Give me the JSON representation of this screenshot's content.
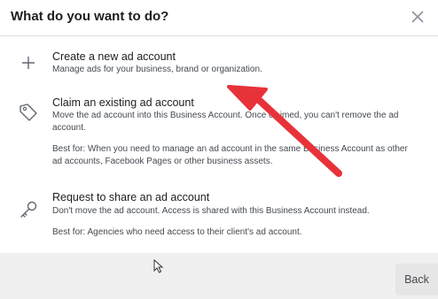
{
  "dialog": {
    "title": "What do you want to do?",
    "options": [
      {
        "icon": "plus-icon",
        "title": "Create a new ad account",
        "desc": "Manage ads for your business, brand or organization."
      },
      {
        "icon": "tag-icon",
        "title": "Claim an existing ad account",
        "desc": "Move the ad account into this Business Account. Once claimed, you can't remove the ad account.",
        "best_for": "Best for: When you need to manage an ad account in the same Business Account as other ad accounts, Facebook Pages or other business assets."
      },
      {
        "icon": "key-icon",
        "title": "Request to share an ad account",
        "desc": "Don't move the ad account. Access is shared with this Business Account instead.",
        "best_for": "Best for: Agencies who need access to their client's ad account."
      }
    ],
    "back_label": "Back"
  },
  "annotation": {
    "arrow_color": "#e8323a"
  }
}
